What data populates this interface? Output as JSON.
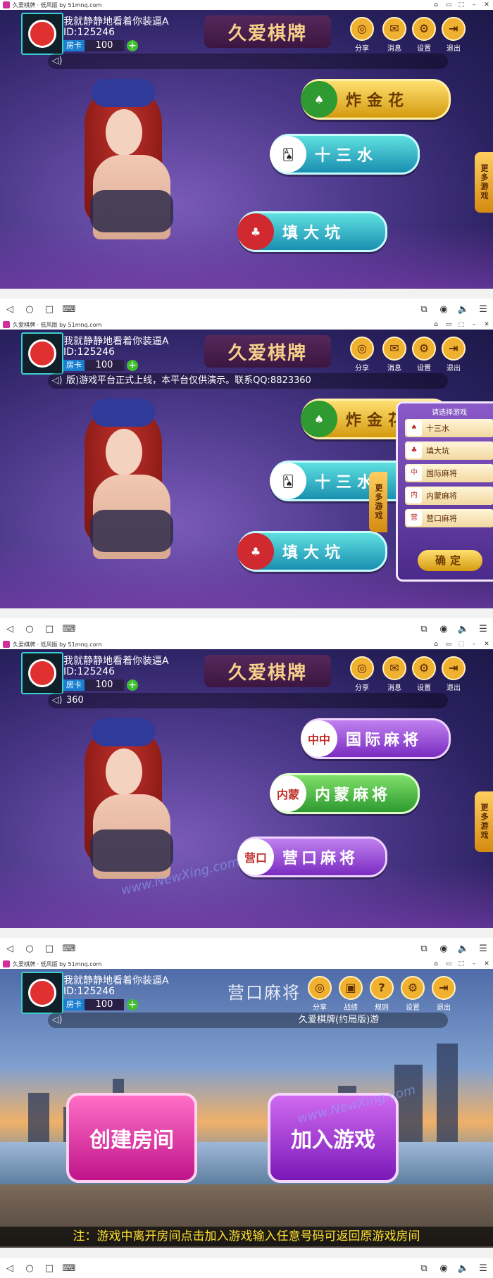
{
  "status": {
    "app_title": "久爱棋牌 · 低风版 by 51mnq.com"
  },
  "player": {
    "nickname": "我就静静地看着你装逼A",
    "id": "ID:125246",
    "card_label": "房卡",
    "card_count": "100",
    "add_symbol": "+"
  },
  "logo": {
    "text": "久爱棋牌"
  },
  "toolbar": {
    "share": "分享",
    "message": "消息",
    "settings": "设置",
    "exit": "退出"
  },
  "panel1": {
    "marquee": "",
    "games": [
      "炸金花",
      "十三水",
      "填大坑"
    ],
    "more_tab": "更多游戏"
  },
  "panel2": {
    "marquee": "版)游戏平台正式上线，本平台仅供演示。联系QQ:8823360",
    "games": [
      "炸金花",
      "十三水",
      "填大坑"
    ],
    "more_tab": "更多游戏",
    "popup": {
      "title": "请选择游戏",
      "items": [
        "十三水",
        "填大坑",
        "国际麻将",
        "内蒙麻将",
        "营口麻将"
      ],
      "confirm": "确定"
    }
  },
  "panel3": {
    "marquee": "360",
    "games": [
      "国际麻将",
      "内蒙麻将",
      "营口麻将"
    ],
    "game_icons": [
      "中中",
      "内蒙",
      "营口"
    ],
    "more_tab": "更多游戏",
    "watermark": "www.NewXing.com"
  },
  "panel4": {
    "title": "营口麻将",
    "toolbar": {
      "share": "分享",
      "record": "战绩",
      "rules": "规则",
      "settings": "设置",
      "exit": "退出"
    },
    "marquee": "久爱棋牌(约局版)游",
    "create_room": "创建房间",
    "join_game": "加入游戏",
    "note": "注：游戏中离开房间点击加入游戏输入任意号码可返回原游戏房间",
    "watermark": "www.NewXing.com"
  },
  "navbar": {
    "back": "◁",
    "home": "○",
    "recent": "□",
    "keyboard": "⌨",
    "multi": "⧉",
    "eye": "◉",
    "volume": "🔈",
    "menu": "☰"
  }
}
